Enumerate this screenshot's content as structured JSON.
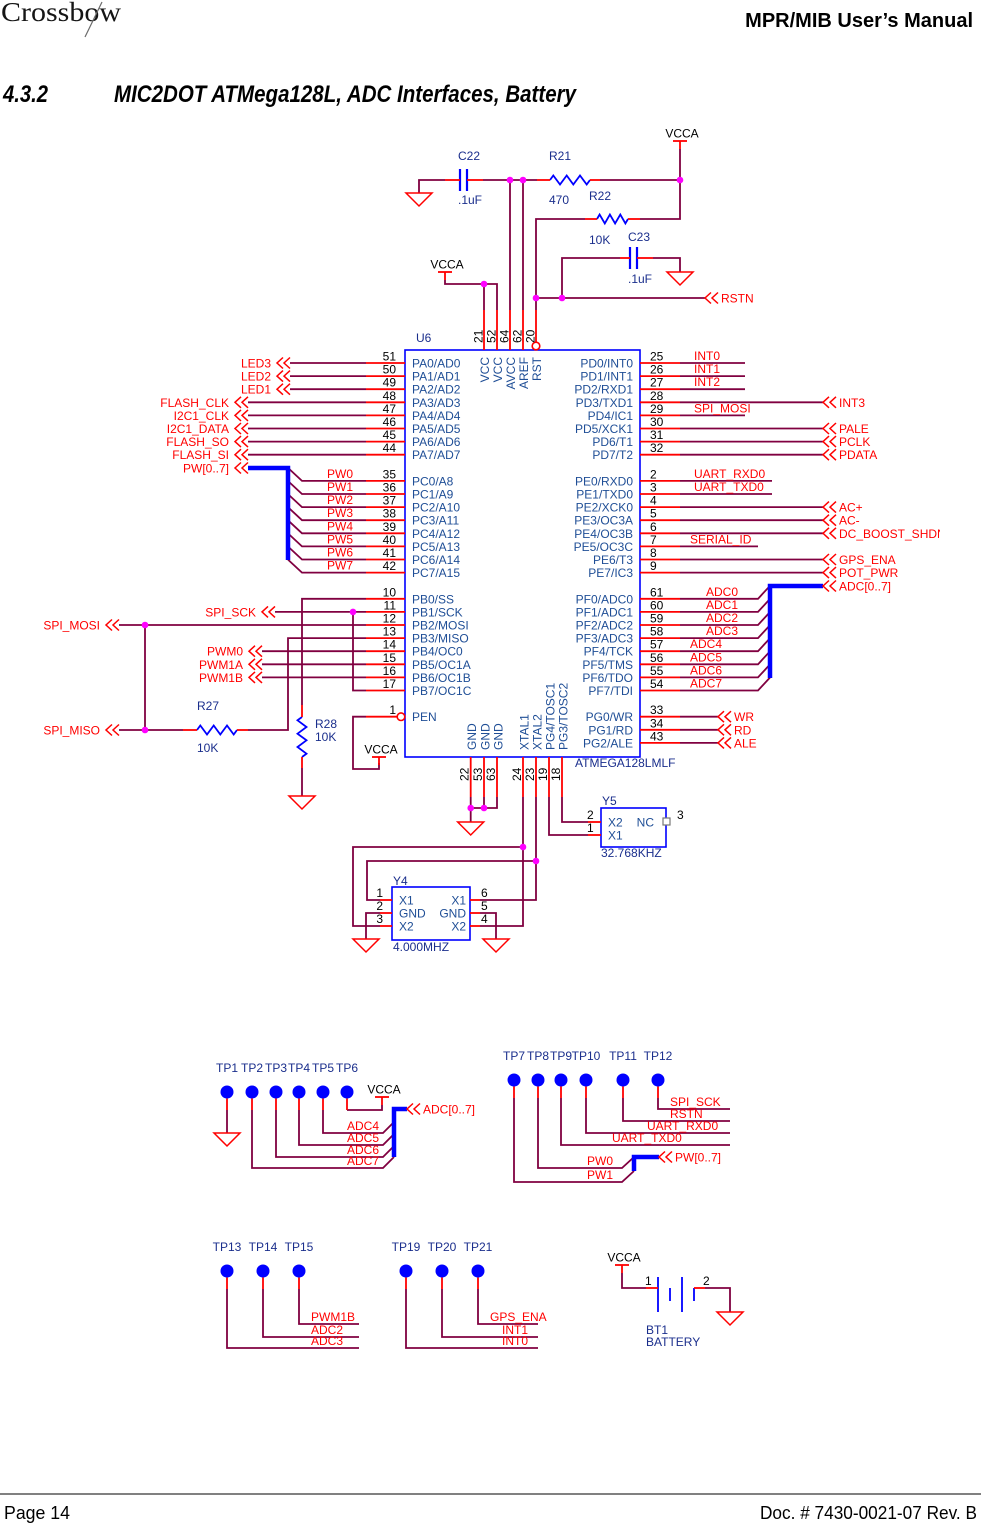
{
  "header": {
    "logo_text": "Crossbow",
    "manual_title": "MPR/MIB User’s Manual"
  },
  "section": {
    "number": "4.3.2",
    "title": "MIC2DOT ATMega128L, ADC Interfaces, Battery"
  },
  "schematic": {
    "power": {
      "vcca": "VCCA"
    },
    "u6": {
      "ref": "U6",
      "part": "ATMEGA128LMLF",
      "top_pins": [
        {
          "num": "21",
          "name": "VCC"
        },
        {
          "num": "52",
          "name": "VCC"
        },
        {
          "num": "64",
          "name": "AVCC"
        },
        {
          "num": "62",
          "name": "AREF"
        },
        {
          "num": "20",
          "name": "RST"
        }
      ],
      "bottom_pins": [
        {
          "num": "22",
          "name": "GND"
        },
        {
          "num": "53",
          "name": "GND"
        },
        {
          "num": "63",
          "name": "GND"
        },
        {
          "num": "24",
          "name": "XTAL1"
        },
        {
          "num": "23",
          "name": "XTAL2"
        },
        {
          "num": "19",
          "name": "PG4/TOSC1"
        },
        {
          "num": "18",
          "name": "PG3/TOSC2"
        }
      ],
      "left_pins": [
        {
          "num": "51",
          "name": "PA0/AD0"
        },
        {
          "num": "50",
          "name": "PA1/AD1"
        },
        {
          "num": "49",
          "name": "PA2/AD2"
        },
        {
          "num": "48",
          "name": "PA3/AD3"
        },
        {
          "num": "47",
          "name": "PA4/AD4"
        },
        {
          "num": "46",
          "name": "PA5/AD5"
        },
        {
          "num": "45",
          "name": "PA6/AD6"
        },
        {
          "num": "44",
          "name": "PA7/AD7"
        },
        {
          "num": "35",
          "name": "PC0/A8"
        },
        {
          "num": "36",
          "name": "PC1/A9"
        },
        {
          "num": "37",
          "name": "PC2/A10"
        },
        {
          "num": "38",
          "name": "PC3/A11"
        },
        {
          "num": "39",
          "name": "PC4/A12"
        },
        {
          "num": "40",
          "name": "PC5/A13"
        },
        {
          "num": "41",
          "name": "PC6/A14"
        },
        {
          "num": "42",
          "name": "PC7/A15"
        },
        {
          "num": "10",
          "name": "PB0/SS"
        },
        {
          "num": "11",
          "name": "PB1/SCK"
        },
        {
          "num": "12",
          "name": "PB2/MOSI"
        },
        {
          "num": "13",
          "name": "PB3/MISO"
        },
        {
          "num": "14",
          "name": "PB4/OC0"
        },
        {
          "num": "15",
          "name": "PB5/OC1A"
        },
        {
          "num": "16",
          "name": "PB6/OC1B"
        },
        {
          "num": "17",
          "name": "PB7/OC1C"
        },
        {
          "num": "1",
          "name": "PEN"
        }
      ],
      "right_pins": [
        {
          "num": "25",
          "name": "PD0/INT0"
        },
        {
          "num": "26",
          "name": "PD1/INT1"
        },
        {
          "num": "27",
          "name": "PD2/RXD1"
        },
        {
          "num": "28",
          "name": "PD3/TXD1"
        },
        {
          "num": "29",
          "name": "PD4/IC1"
        },
        {
          "num": "30",
          "name": "PD5/XCK1"
        },
        {
          "num": "31",
          "name": "PD6/T1"
        },
        {
          "num": "32",
          "name": "PD7/T2"
        },
        {
          "num": "2",
          "name": "PE0/RXD0"
        },
        {
          "num": "3",
          "name": "PE1/TXD0"
        },
        {
          "num": "4",
          "name": "PE2/XCK0"
        },
        {
          "num": "5",
          "name": "PE3/OC3A"
        },
        {
          "num": "6",
          "name": "PE4/OC3B"
        },
        {
          "num": "7",
          "name": "PE5/OC3C"
        },
        {
          "num": "8",
          "name": "PE6/T3"
        },
        {
          "num": "9",
          "name": "PE7/IC3"
        },
        {
          "num": "61",
          "name": "PF0/ADC0"
        },
        {
          "num": "60",
          "name": "PF1/ADC1"
        },
        {
          "num": "59",
          "name": "PF2/ADC2"
        },
        {
          "num": "58",
          "name": "PF3/ADC3"
        },
        {
          "num": "57",
          "name": "PF4/TCK"
        },
        {
          "num": "56",
          "name": "PF5/TMS"
        },
        {
          "num": "55",
          "name": "PF6/TDO"
        },
        {
          "num": "54",
          "name": "PF7/TDI"
        },
        {
          "num": "33",
          "name": "PG0/WR"
        },
        {
          "num": "34",
          "name": "PG1/RD"
        },
        {
          "num": "43",
          "name": "PG2/ALE"
        }
      ]
    },
    "components": {
      "c22": {
        "ref": "C22",
        "value": ".1uF"
      },
      "c23": {
        "ref": "C23",
        "value": ".1uF"
      },
      "r21": {
        "ref": "R21",
        "value": "470"
      },
      "r22": {
        "ref": "R22",
        "value": "10K"
      },
      "r27": {
        "ref": "R27",
        "value": "10K"
      },
      "r28": {
        "ref": "R28",
        "value": "10K"
      },
      "y4": {
        "ref": "Y4",
        "value": "4.000MHZ",
        "left_pins": [
          {
            "num": "1",
            "name": "X1"
          },
          {
            "num": "2",
            "name": "GND"
          },
          {
            "num": "3",
            "name": "X2"
          }
        ],
        "right_pins": [
          {
            "num": "6",
            "name": "X1"
          },
          {
            "num": "5",
            "name": "GND"
          },
          {
            "num": "4",
            "name": "X2"
          }
        ]
      },
      "y5": {
        "ref": "Y5",
        "value": "32.768KHZ",
        "pins": [
          {
            "num": "2",
            "name": "X2"
          },
          {
            "num": "1",
            "name": "X1"
          }
        ],
        "nc_pin": {
          "num": "3",
          "name": "NC"
        }
      },
      "bt1": {
        "ref": "BT1",
        "value": "BATTERY",
        "pins": [
          "1",
          "2"
        ]
      }
    },
    "nets": {
      "left_ports": [
        "LED3",
        "LED2",
        "LED1",
        "FLASH_CLK",
        "I2C1_CLK",
        "I2C1_DATA",
        "FLASH_SO",
        "FLASH_SI",
        "PW[0..7]",
        "SPI_SCK",
        "SPI_MOSI",
        "PWM0",
        "PWM1A",
        "PWM1B",
        "SPI_MISO"
      ],
      "pw_labels": [
        "PW0",
        "PW1",
        "PW2",
        "PW3",
        "PW4",
        "PW5",
        "PW6",
        "PW7"
      ],
      "right_labels": [
        "INT0",
        "INT1",
        "INT2",
        "SPI_MOSI",
        "UART_RXD0",
        "UART_TXD0",
        "SERIAL_ID",
        "ADC0",
        "ADC1",
        "ADC2",
        "ADC3",
        "ADC4",
        "ADC5",
        "ADC6",
        "ADC7"
      ],
      "right_ports": [
        "INT3",
        "PALE",
        "PCLK",
        "PDATA",
        "AC+",
        "AC-",
        "DC_BOOST_SHDN",
        "GPS_ENA",
        "POT_PWR",
        "ADC[0..7]",
        "WR",
        "RD",
        "ALE"
      ],
      "reset_port": "RSTN"
    },
    "test_points": [
      {
        "ref": "TP1"
      },
      {
        "ref": "TP2",
        "net": "ADC7"
      },
      {
        "ref": "TP3",
        "net": "ADC6"
      },
      {
        "ref": "TP4",
        "net": "ADC5"
      },
      {
        "ref": "TP5",
        "net": "ADC4"
      },
      {
        "ref": "TP6"
      },
      {
        "ref": "TP7",
        "net": "PW1"
      },
      {
        "ref": "TP8",
        "net": "PW0"
      },
      {
        "ref": "TP9",
        "net": "UART_TXD0"
      },
      {
        "ref": "TP10",
        "net": "UART_RXD0"
      },
      {
        "ref": "TP11",
        "net": "RSTN"
      },
      {
        "ref": "TP12",
        "net": "SPI_SCK"
      },
      {
        "ref": "TP13",
        "net": "ADC3"
      },
      {
        "ref": "TP14",
        "net": "ADC2"
      },
      {
        "ref": "TP15",
        "net": "PWM1B"
      },
      {
        "ref": "TP19",
        "net": "INT0"
      },
      {
        "ref": "TP20",
        "net": "INT1"
      },
      {
        "ref": "TP21",
        "net": "GPS_ENA"
      }
    ],
    "test_point_buses": [
      "ADC[0..7]",
      "PW[0..7]"
    ]
  },
  "footer": {
    "page": "Page 14",
    "document": "Doc. # 7430-0021-07 Rev. B"
  }
}
